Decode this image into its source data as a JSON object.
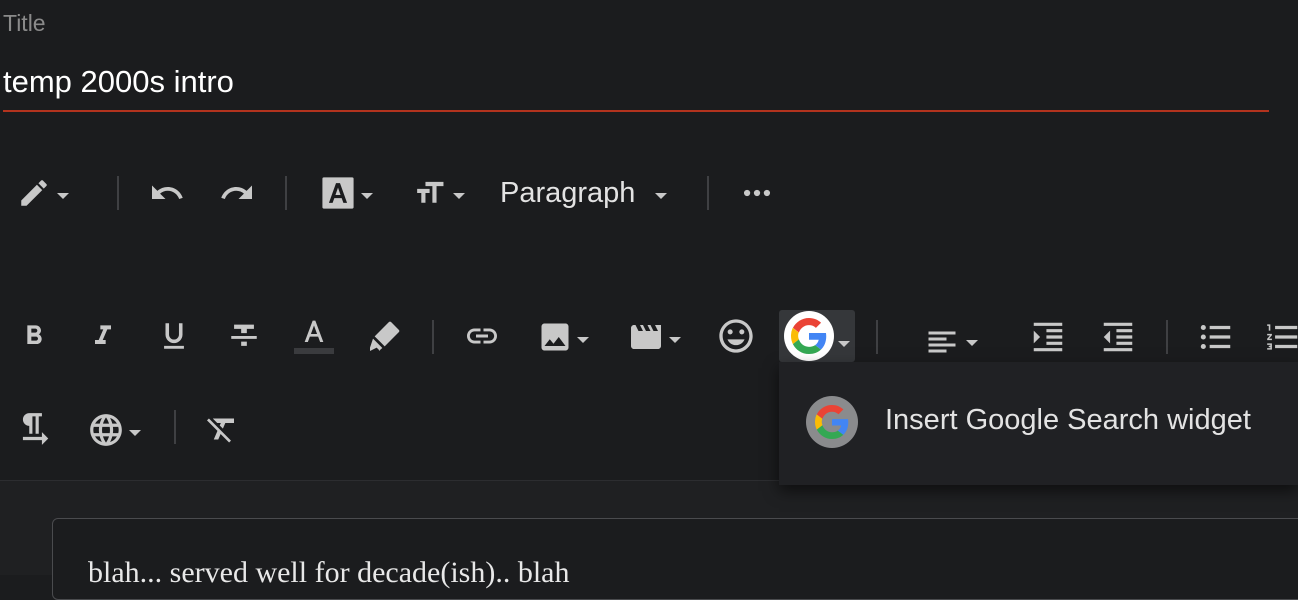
{
  "form": {
    "title_label": "Title",
    "title_value": "temp 2000s intro"
  },
  "toolbar": {
    "block_format_label": "Paragraph",
    "google_widget_item": "Insert Google Search widget"
  },
  "editor": {
    "content_text": "blah... served well for decade(ish).. blah"
  },
  "colors": {
    "accent_underline": "#b3331e",
    "icon": "#c8c8c8",
    "background": "#1b1c1e"
  },
  "icons": [
    "pencil-icon",
    "undo-icon",
    "redo-icon",
    "text-style-icon",
    "font-size-icon",
    "more-icon",
    "bold-icon",
    "italic-icon",
    "underline-icon",
    "strikethrough-icon",
    "text-color-icon",
    "highlight-icon",
    "link-icon",
    "image-icon",
    "video-icon",
    "emoji-icon",
    "google-icon",
    "align-left-icon",
    "indent-icon",
    "outdent-icon",
    "bulleted-list-icon",
    "numbered-list-icon",
    "paragraph-direction-icon",
    "globe-icon",
    "clear-format-icon"
  ]
}
